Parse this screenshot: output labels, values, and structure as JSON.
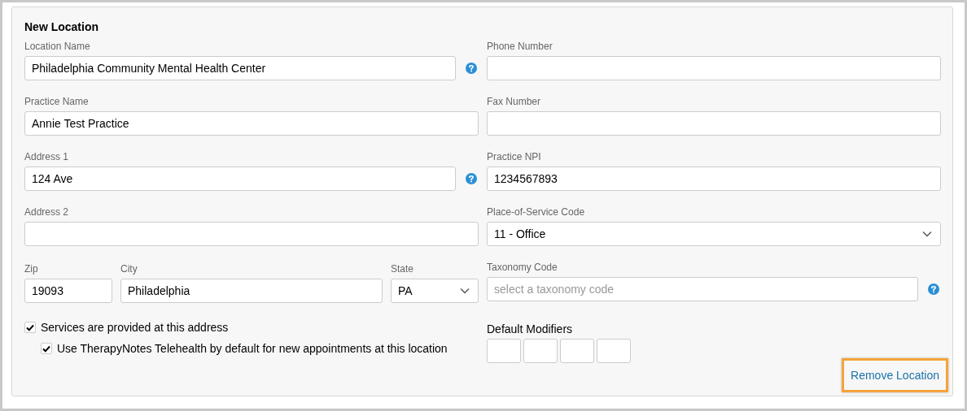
{
  "title": "New Location",
  "left": [
    {
      "label": "Location Name",
      "kind": "text",
      "value": "Philadelphia Community Mental Health Center",
      "help": true
    },
    {
      "label": "Practice Name",
      "kind": "text",
      "value": "Annie Test Practice",
      "help": false
    },
    {
      "label": "Address 1",
      "kind": "text",
      "value": "124 Ave",
      "help": true
    },
    {
      "label": "Address 2",
      "kind": "text",
      "help": false
    }
  ],
  "address_row": [
    {
      "label": "Zip",
      "kind": "text",
      "value": "19093"
    },
    {
      "label": "City",
      "kind": "text",
      "value": "Philadelphia"
    },
    {
      "label": "State",
      "kind": "select",
      "value": "PA"
    }
  ],
  "checkboxes": [
    {
      "label": "Services are provided at this address",
      "checked": true,
      "children": [
        {
          "label": "Use TherapyNotes Telehealth by default for new appointments at this location",
          "checked": true
        }
      ]
    }
  ],
  "right": [
    {
      "label": "Phone Number",
      "kind": "text",
      "help": false
    },
    {
      "label": "Fax Number",
      "kind": "text",
      "help": false
    },
    {
      "label": "Practice NPI",
      "kind": "text",
      "value": "1234567893",
      "help": false
    },
    {
      "label": "Place-of-Service Code",
      "kind": "select",
      "value": "11 - Office",
      "help": false
    },
    {
      "label": "Taxonomy Code",
      "kind": "text",
      "placeholder": "select a taxonomy code",
      "help": true
    }
  ],
  "default_modifiers": {
    "label": "Default Modifiers",
    "fields": [
      {
        "kind": "text"
      },
      {
        "kind": "text"
      },
      {
        "kind": "text"
      },
      {
        "kind": "text"
      }
    ]
  },
  "remove_link": {
    "label": "Remove Location",
    "focused": true
  }
}
